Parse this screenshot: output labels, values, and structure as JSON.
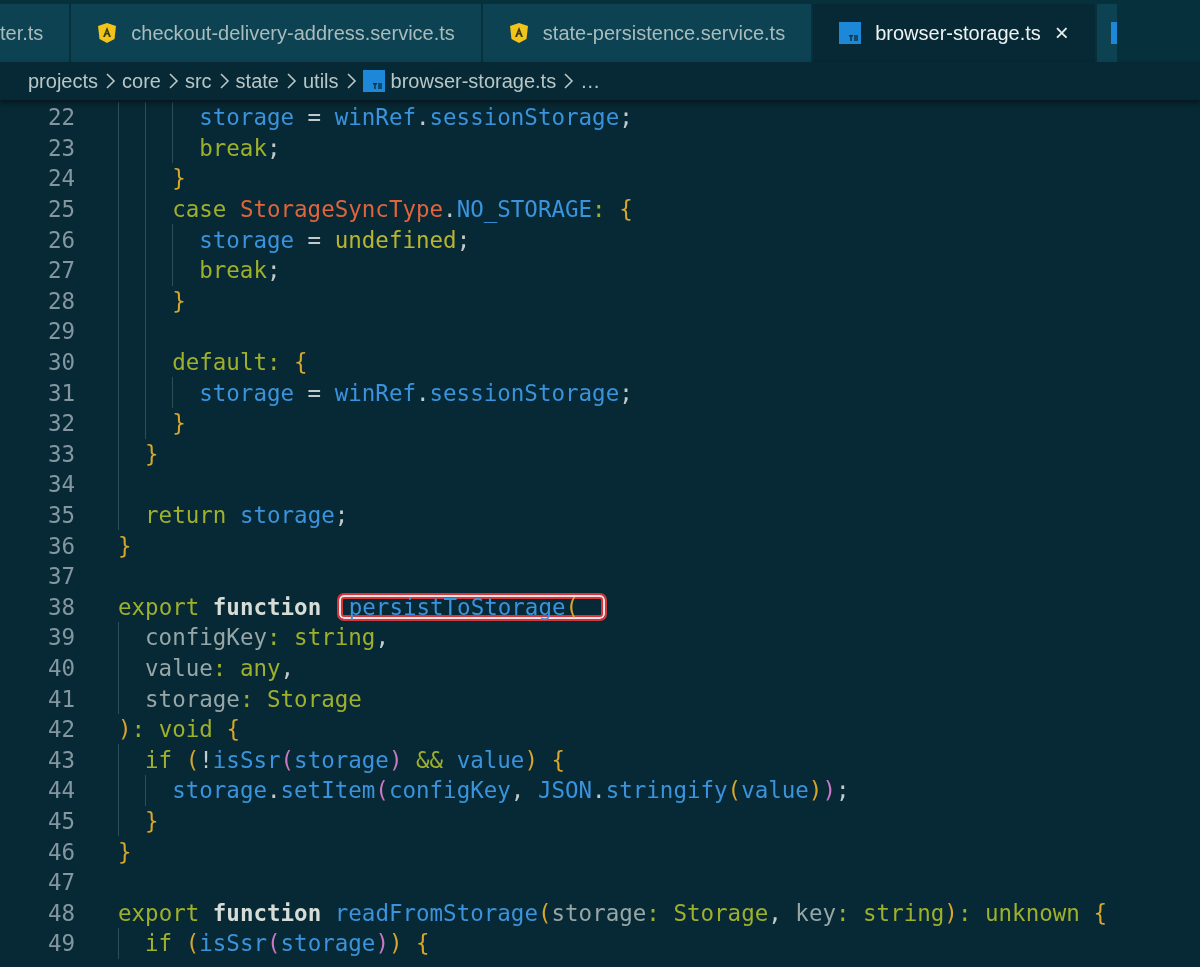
{
  "tabs": [
    {
      "label": "ter.ts",
      "selected": false
    },
    {
      "label": "checkout-delivery-address.service.ts",
      "kind": "angular",
      "selected": false
    },
    {
      "label": "state-persistence.service.ts",
      "kind": "angular",
      "selected": false
    },
    {
      "label": "browser-storage.ts",
      "kind": "ts",
      "selected": true,
      "close": "×"
    },
    {
      "kind": "ts",
      "selected": false
    }
  ],
  "breadcrumb": [
    {
      "label": "projects"
    },
    {
      "label": "core"
    },
    {
      "label": "src"
    },
    {
      "label": "state"
    },
    {
      "label": "utils"
    },
    {
      "label": "browser-storage.ts",
      "kind": "ts"
    },
    {
      "label": "…"
    }
  ],
  "lines": [
    {
      "children": [
        {
          "children": [
            {
              "children": [
                {
                  "number": "22",
                  "tokens": [
                    {
                      "kind": "var",
                      "text": "storage"
                    },
                    {
                      "kind": "op",
                      "text": " = "
                    },
                    {
                      "kind": "var",
                      "text": "winRef"
                    },
                    {
                      "kind": "op",
                      "text": "."
                    },
                    {
                      "kind": "var",
                      "text": "sessionStorage"
                    },
                    {
                      "kind": "op",
                      "text": ";"
                    }
                  ]
                },
                {
                  "number": "23",
                  "tokens": [
                    {
                      "kind": "kw",
                      "text": "break"
                    },
                    {
                      "kind": "op",
                      "text": ";"
                    }
                  ]
                }
              ]
            },
            {
              "number": "24",
              "tokens": [
                {
                  "kind": "brace",
                  "text": "}"
                }
              ]
            },
            {
              "number": "25",
              "tokens": [
                {
                  "kind": "kw",
                  "text": "case "
                },
                {
                  "kind": "cls",
                  "text": "StorageSyncType"
                },
                {
                  "kind": "op",
                  "text": "."
                },
                {
                  "kind": "var",
                  "text": "NO_STORAGE"
                },
                {
                  "kind": "kw",
                  "text": ": "
                },
                {
                  "kind": "brace",
                  "text": "{"
                }
              ],
              "children": [
                {
                  "number": "26",
                  "tokens": [
                    {
                      "kind": "var",
                      "text": "storage"
                    },
                    {
                      "kind": "op",
                      "text": " = "
                    },
                    {
                      "kind": "const",
                      "text": "undefined"
                    },
                    {
                      "kind": "op",
                      "text": ";"
                    }
                  ]
                },
                {
                  "number": "27",
                  "tokens": [
                    {
                      "kind": "kw",
                      "text": "break"
                    },
                    {
                      "kind": "op",
                      "text": ";"
                    }
                  ]
                }
              ]
            },
            {
              "number": "28",
              "tokens": [
                {
                  "kind": "brace",
                  "text": "}"
                }
              ]
            },
            {
              "number": "29"
            },
            {
              "number": "30",
              "tokens": [
                {
                  "kind": "kw",
                  "text": "default"
                },
                {
                  "kind": "kw",
                  "text": ": "
                },
                {
                  "kind": "brace",
                  "text": "{"
                }
              ],
              "children": [
                {
                  "number": "31",
                  "tokens": [
                    {
                      "kind": "var",
                      "text": "storage"
                    },
                    {
                      "kind": "op",
                      "text": " = "
                    },
                    {
                      "kind": "var",
                      "text": "winRef"
                    },
                    {
                      "kind": "op",
                      "text": "."
                    },
                    {
                      "kind": "var",
                      "text": "sessionStorage"
                    },
                    {
                      "kind": "op",
                      "text": ";"
                    }
                  ]
                }
              ]
            },
            {
              "number": "32",
              "tokens": [
                {
                  "kind": "brace",
                  "text": "}"
                }
              ]
            }
          ]
        },
        {
          "number": "33",
          "tokens": [
            {
              "kind": "brace",
              "text": "}"
            }
          ]
        },
        {
          "number": "34"
        },
        {
          "number": "35",
          "tokens": [
            {
              "kind": "kw",
              "text": "return "
            },
            {
              "kind": "var",
              "text": "storage"
            },
            {
              "kind": "op",
              "text": ";"
            }
          ]
        }
      ]
    },
    {
      "number": "36",
      "tokens": [
        {
          "kind": "brace",
          "text": "}"
        }
      ]
    },
    {
      "number": "37"
    },
    {
      "number": "38",
      "tokens": [
        {
          "kind": "kw",
          "text": "export "
        },
        {
          "kind": "fn",
          "text": "function "
        },
        {
          "kind": "var",
          "text": "persistToStorage",
          "boxed": true
        },
        {
          "kind": "brace",
          "text": "(",
          "boxed": true
        }
      ],
      "children": [
        {
          "number": "39",
          "tokens": [
            {
              "kind": "param",
              "text": "configKey"
            },
            {
              "kind": "kw",
              "text": ": "
            },
            {
              "kind": "type",
              "text": "string"
            },
            {
              "kind": "op",
              "text": ","
            }
          ]
        },
        {
          "number": "40",
          "tokens": [
            {
              "kind": "param",
              "text": "value"
            },
            {
              "kind": "kw",
              "text": ": "
            },
            {
              "kind": "type",
              "text": "any"
            },
            {
              "kind": "op",
              "text": ","
            }
          ]
        },
        {
          "number": "41",
          "tokens": [
            {
              "kind": "param",
              "text": "storage"
            },
            {
              "kind": "kw",
              "text": ": "
            },
            {
              "kind": "type",
              "text": "Storage"
            }
          ]
        }
      ]
    },
    {
      "number": "42",
      "tokens": [
        {
          "kind": "brace",
          "text": ")"
        },
        {
          "kind": "kw",
          "text": ": "
        },
        {
          "kind": "type",
          "text": "void "
        },
        {
          "kind": "brace",
          "text": "{"
        }
      ],
      "children": [
        {
          "number": "43",
          "tokens": [
            {
              "kind": "kw",
              "text": "if "
            },
            {
              "kind": "brace",
              "text": "("
            },
            {
              "kind": "op",
              "text": "!"
            },
            {
              "kind": "var",
              "text": "isSsr"
            },
            {
              "kind": "paren",
              "text": "("
            },
            {
              "kind": "var",
              "text": "storage"
            },
            {
              "kind": "paren",
              "text": ")"
            },
            {
              "kind": "kw",
              "text": " && "
            },
            {
              "kind": "var",
              "text": "value"
            },
            {
              "kind": "brace",
              "text": ") {"
            }
          ],
          "children": [
            {
              "number": "44",
              "tokens": [
                {
                  "kind": "var",
                  "text": "storage"
                },
                {
                  "kind": "op",
                  "text": "."
                },
                {
                  "kind": "var",
                  "text": "setItem"
                },
                {
                  "kind": "paren",
                  "text": "("
                },
                {
                  "kind": "var",
                  "text": "configKey"
                },
                {
                  "kind": "op",
                  "text": ", "
                },
                {
                  "kind": "var",
                  "text": "JSON"
                },
                {
                  "kind": "op",
                  "text": "."
                },
                {
                  "kind": "var",
                  "text": "stringify"
                },
                {
                  "kind": "brace",
                  "text": "("
                },
                {
                  "kind": "var",
                  "text": "value"
                },
                {
                  "kind": "brace",
                  "text": ")"
                },
                {
                  "kind": "paren",
                  "text": ")"
                },
                {
                  "kind": "op",
                  "text": ";"
                }
              ]
            }
          ]
        },
        {
          "number": "45",
          "tokens": [
            {
              "kind": "brace",
              "text": "}"
            }
          ]
        }
      ]
    },
    {
      "number": "46",
      "tokens": [
        {
          "kind": "brace",
          "text": "}"
        }
      ]
    },
    {
      "number": "47"
    },
    {
      "number": "48",
      "tokens": [
        {
          "kind": "kw",
          "text": "export "
        },
        {
          "kind": "fn",
          "text": "function "
        },
        {
          "kind": "var",
          "text": "readFromStorage"
        },
        {
          "kind": "brace",
          "text": "("
        },
        {
          "kind": "param",
          "text": "storage"
        },
        {
          "kind": "kw",
          "text": ": "
        },
        {
          "kind": "type",
          "text": "Storage"
        },
        {
          "kind": "op",
          "text": ", "
        },
        {
          "kind": "param",
          "text": "key"
        },
        {
          "kind": "kw",
          "text": ": "
        },
        {
          "kind": "type",
          "text": "string"
        },
        {
          "kind": "brace",
          "text": ")"
        },
        {
          "kind": "kw",
          "text": ": "
        },
        {
          "kind": "type",
          "text": "unknown "
        },
        {
          "kind": "brace",
          "text": "{"
        }
      ],
      "children": [
        {
          "number": "49",
          "tokens": [
            {
              "kind": "kw",
              "text": "if "
            },
            {
              "kind": "brace",
              "text": "("
            },
            {
              "kind": "var",
              "text": "isSsr"
            },
            {
              "kind": "paren",
              "text": "("
            },
            {
              "kind": "var",
              "text": "storage"
            },
            {
              "kind": "paren",
              "text": ")"
            },
            {
              "kind": "brace",
              "text": ") {"
            }
          ]
        }
      ]
    }
  ]
}
